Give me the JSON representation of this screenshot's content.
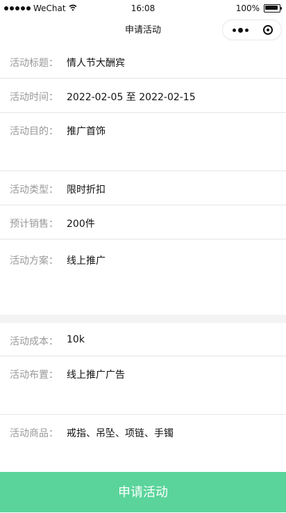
{
  "status_bar": {
    "carrier": "WeChat",
    "time": "16:08",
    "battery": "100%"
  },
  "nav": {
    "title": "申请活动"
  },
  "icons": {
    "more": "more-dots-icon",
    "target": "target-icon",
    "signal": "signal-dots-icon",
    "wifi": "wifi-icon",
    "battery": "battery-icon"
  },
  "form": {
    "rows": [
      {
        "label": "活动标题：",
        "value": "情人节大酬宾"
      },
      {
        "label": "活动时间：",
        "value": "2022-02-05 至 2022-02-15"
      },
      {
        "label": "活动目的：",
        "value": "推广首饰"
      },
      {
        "label": "活动类型：",
        "value": "限时折扣"
      },
      {
        "label": "预计销售：",
        "value": "200件"
      },
      {
        "label": "活动方案：",
        "value": "线上推广"
      }
    ],
    "rows2": [
      {
        "label": "活动成本：",
        "value": "10k"
      },
      {
        "label": "活动布置：",
        "value": "线上推广广告"
      },
      {
        "label": "活动商品：",
        "value": "戒指、吊坠、项链、手镯"
      }
    ]
  },
  "button": {
    "label": "申请活动",
    "color": "#5ad49b"
  }
}
